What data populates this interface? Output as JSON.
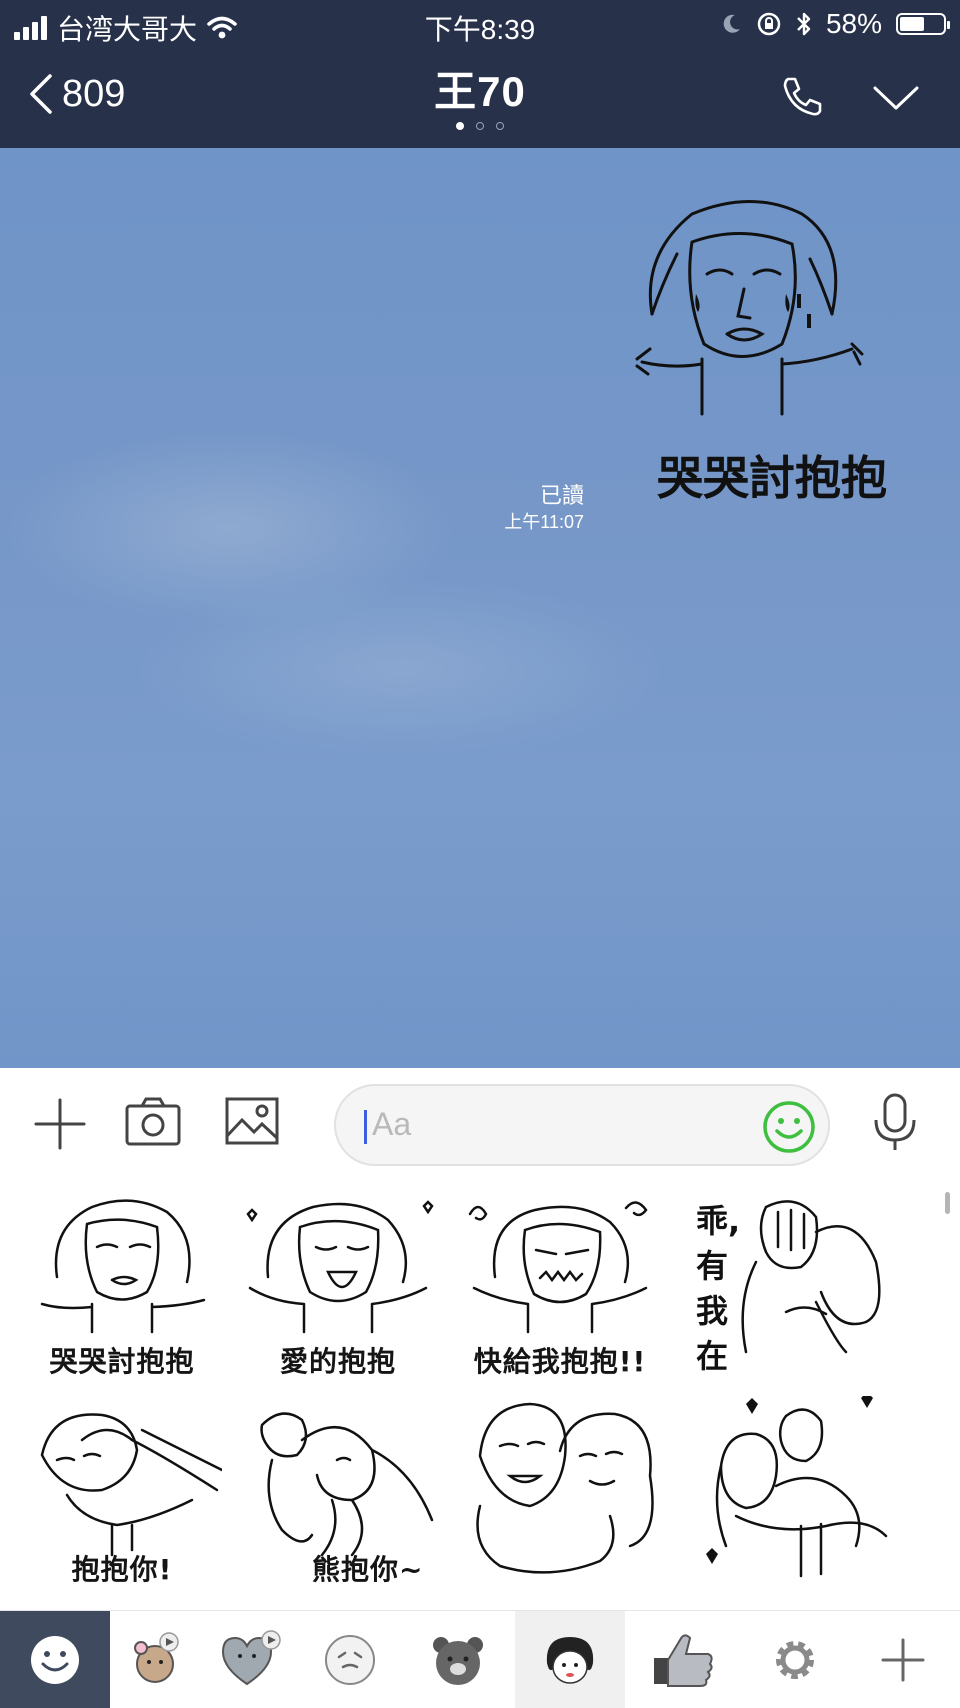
{
  "status_bar": {
    "carrier": "台湾大哥大",
    "time": "下午8:39",
    "battery": "58%",
    "battery_level": 0.58
  },
  "header": {
    "back_label": "809",
    "chat_title": "王70",
    "page_count": 3,
    "active_page": 1
  },
  "chat": {
    "message": {
      "type": "sticker",
      "caption": "哭哭討抱抱",
      "read_label": "已讀",
      "time": "上午11:07"
    }
  },
  "input": {
    "placeholder": "Aa"
  },
  "sticker_panel": {
    "stickers": [
      {
        "name": "crying-hug",
        "caption": "哭哭討抱抱"
      },
      {
        "name": "love-hug",
        "caption": "愛的抱抱"
      },
      {
        "name": "hurry-hug",
        "caption": "快給我抱抱!!"
      },
      {
        "name": "there-there",
        "caption": "乖,有我在"
      },
      {
        "name": "hug-you",
        "caption": "抱抱你!"
      },
      {
        "name": "bear-hug",
        "caption": "熊抱你~"
      },
      {
        "name": "cheek-hug",
        "caption": ""
      },
      {
        "name": "carry-hug",
        "caption": ""
      }
    ]
  },
  "tabs": {
    "items": [
      "emoji",
      "cony-brown",
      "heart-bear",
      "moon",
      "brown-bear",
      "girl",
      "thumbs-up",
      "settings",
      "add"
    ],
    "selected": "girl"
  },
  "colors": {
    "header_bg": "#27314a",
    "chat_bg": "#7498ca",
    "emoji_green": "#3fbf3f"
  }
}
